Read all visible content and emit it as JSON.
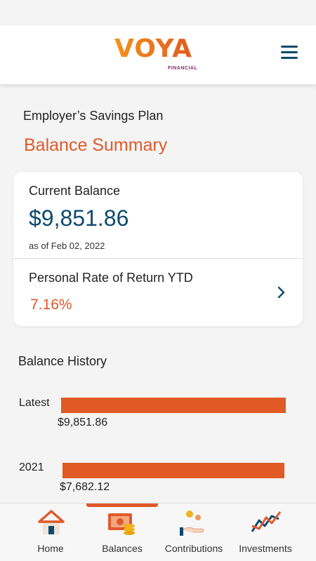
{
  "header": {
    "logo_text": "VOYA",
    "logo_sub": "FINANCIAL",
    "menu_icon": "hamburger-menu-icon"
  },
  "plan": {
    "name": "Employer’s Savings Plan",
    "title": "Balance Summary"
  },
  "summary_card": {
    "current_balance_label": "Current Balance",
    "current_balance_value": "$9,851.86",
    "as_of": "as of Feb 02, 2022",
    "rate_label": "Personal Rate of Return YTD",
    "rate_value": "7.16%",
    "chevron_icon": "chevron-right-icon"
  },
  "history": {
    "title": "Balance History",
    "rows": [
      {
        "label": "Latest",
        "amount": "$9,851.86",
        "value": 9851.86
      },
      {
        "label": "2021",
        "amount": "$7,682.12",
        "value": 7682.12
      }
    ]
  },
  "tabs": [
    {
      "label": "Home",
      "icon": "home-icon",
      "active": false
    },
    {
      "label": "Balances",
      "icon": "balances-icon",
      "active": true
    },
    {
      "label": "Contributions",
      "icon": "contributions-icon",
      "active": false
    },
    {
      "label": "Investments",
      "icon": "investments-icon",
      "active": false
    }
  ],
  "colors": {
    "accent": "#e0592a",
    "primary": "#0d4a6e",
    "bar": "#e15a25"
  }
}
